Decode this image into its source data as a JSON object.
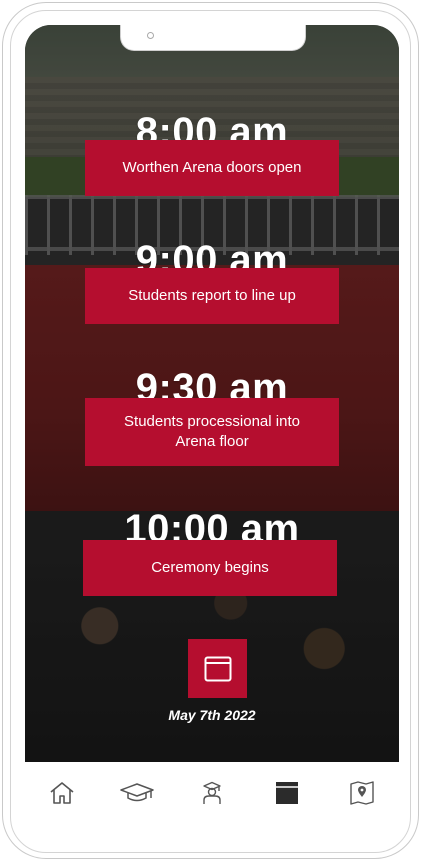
{
  "schedule": [
    {
      "time": "8:00 am",
      "label": "Worthen Arena doors open"
    },
    {
      "time": "9:00 am",
      "label": "Students report to line up"
    },
    {
      "time": "9:30 am",
      "label": "Students processional into Arena floor"
    },
    {
      "time": "10:00 am",
      "label": "Ceremony begins"
    }
  ],
  "date": "May 7th 2022",
  "colors": {
    "accent": "#b50e2f",
    "tab_active": "#2b2b2b",
    "tab_inactive": "#555555"
  },
  "tabs": [
    {
      "icon": "home-icon",
      "active": false
    },
    {
      "icon": "graduation-cap-icon",
      "active": false
    },
    {
      "icon": "graduate-person-icon",
      "active": false
    },
    {
      "icon": "calendar-icon",
      "active": true
    },
    {
      "icon": "map-icon",
      "active": false
    }
  ]
}
